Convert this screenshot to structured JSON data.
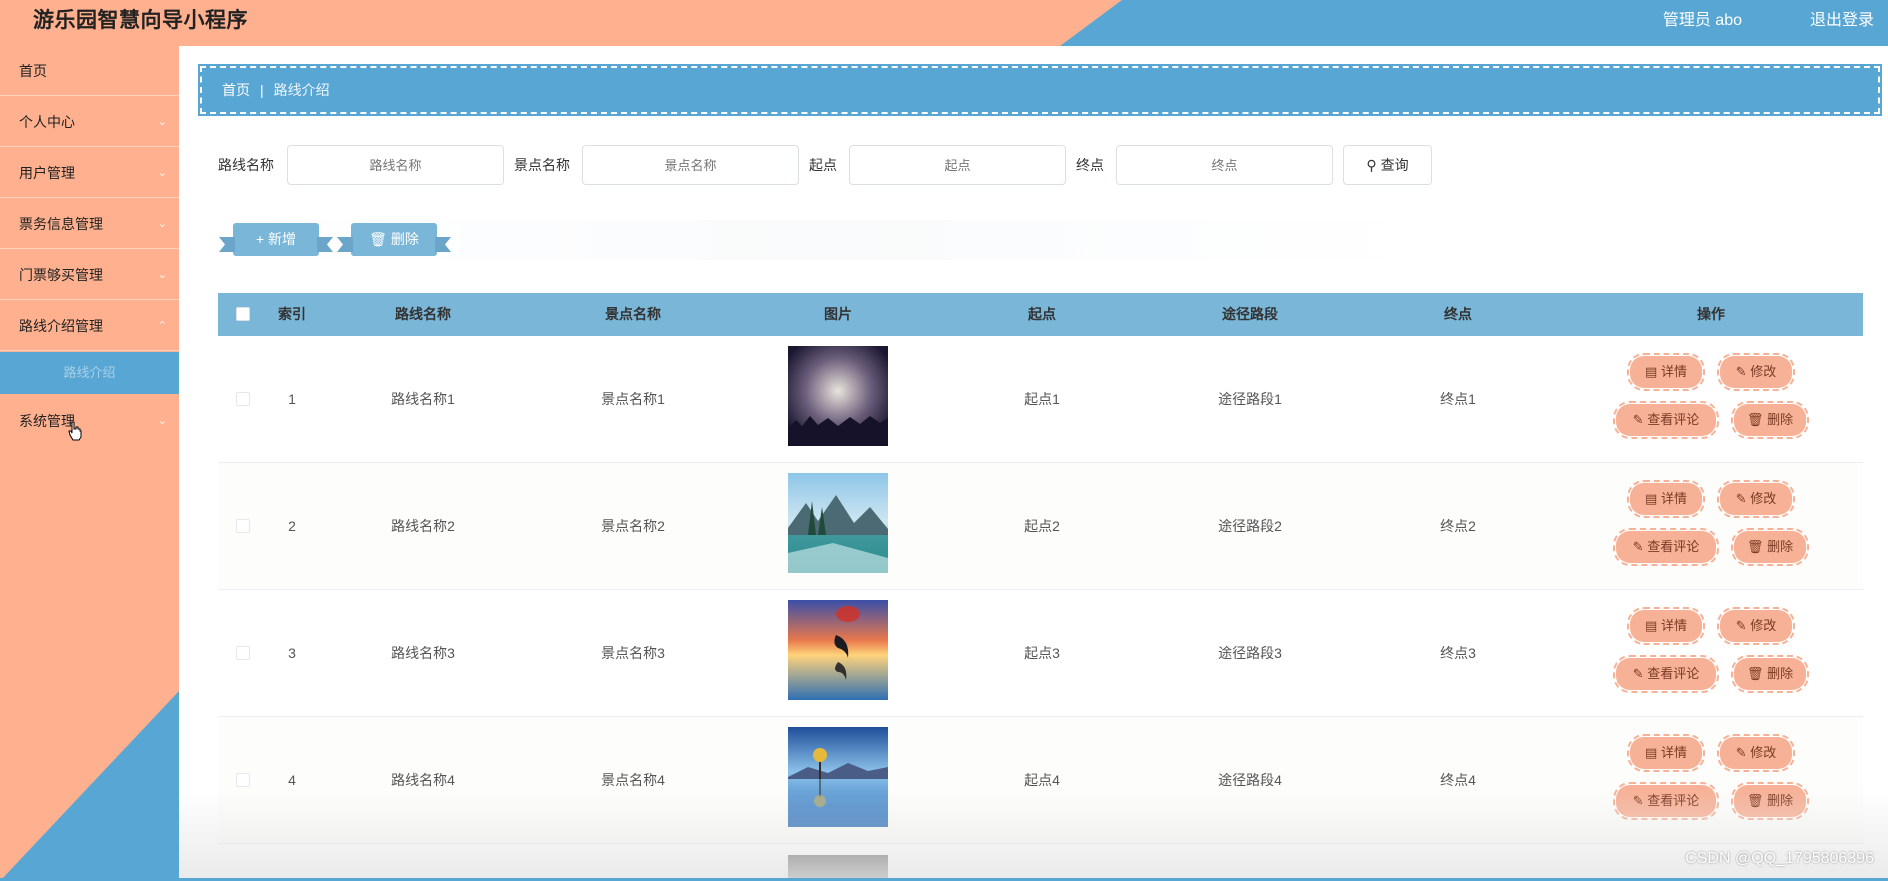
{
  "app": {
    "title": "游乐园智慧向导小程序",
    "user_label": "管理员 abo",
    "logout_label": "退出登录"
  },
  "colors": {
    "salmon": "#ffb18f",
    "blue": "#58a6d3",
    "table_header": "#7ab6d8",
    "op_button": "#f7b197"
  },
  "sidebar": {
    "items": [
      {
        "label": "首页",
        "chevron": false
      },
      {
        "label": "个人中心",
        "chevron": true
      },
      {
        "label": "用户管理",
        "chevron": true
      },
      {
        "label": "票务信息管理",
        "chevron": true
      },
      {
        "label": "门票够买管理",
        "chevron": true
      },
      {
        "label": "路线介绍管理",
        "chevron": true
      },
      {
        "label": "系统管理",
        "chevron": true
      }
    ],
    "active_submenu": "路线介绍",
    "chevron_icon": "chevron-down-icon"
  },
  "breadcrumb": {
    "home": "首页",
    "separator": "|",
    "current": "路线介绍"
  },
  "search": {
    "fields": [
      {
        "label": "路线名称",
        "placeholder": "路线名称"
      },
      {
        "label": "景点名称",
        "placeholder": "景点名称"
      },
      {
        "label": "起点",
        "placeholder": "起点"
      },
      {
        "label": "终点",
        "placeholder": "终点"
      }
    ],
    "button_label": "查询",
    "button_icon": "search-icon"
  },
  "actions": {
    "add_label": "新增",
    "add_icon": "plus-icon",
    "delete_label": "删除",
    "delete_icon": "trash-icon"
  },
  "table": {
    "columns": [
      "索引",
      "路线名称",
      "景点名称",
      "图片",
      "起点",
      "途径路段",
      "终点",
      "操作"
    ],
    "rows": [
      {
        "index": "1",
        "route": "路线名称1",
        "spot": "景点名称1",
        "image": "night-mist-thumbnail",
        "start": "起点1",
        "via": "途径路段1",
        "end": "终点1"
      },
      {
        "index": "2",
        "route": "路线名称2",
        "spot": "景点名称2",
        "image": "mountain-lake-thumbnail",
        "start": "起点2",
        "via": "途径路段2",
        "end": "终点2"
      },
      {
        "index": "3",
        "route": "路线名称3",
        "spot": "景点名称3",
        "image": "sunset-dolphin-thumbnail",
        "start": "起点3",
        "via": "途径路段3",
        "end": "终点3"
      },
      {
        "index": "4",
        "route": "路线名称4",
        "spot": "景点名称4",
        "image": "tree-lake-thumbnail",
        "start": "起点4",
        "via": "途径路段4",
        "end": "终点4"
      }
    ],
    "row_actions": {
      "detail": "详情",
      "edit": "修改",
      "comments": "查看评论",
      "delete": "删除"
    }
  },
  "watermark": "CSDN @QQ_1795806396"
}
